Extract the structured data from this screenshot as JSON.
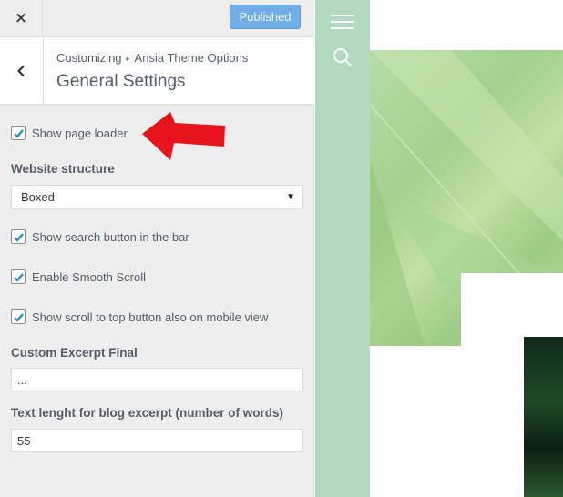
{
  "topbar": {
    "close_label": "×",
    "publish_label": "Published"
  },
  "section": {
    "breadcrumb_root": "Customizing",
    "breadcrumb_separator": "▸",
    "breadcrumb_parent": "Ansia Theme Options",
    "title": "General Settings"
  },
  "controls": {
    "show_page_loader": {
      "label": "Show page loader",
      "checked": true
    },
    "website_structure": {
      "title": "Website structure",
      "value": "Boxed"
    },
    "show_search_button": {
      "label": "Show search button in the bar",
      "checked": true
    },
    "smooth_scroll": {
      "label": "Enable Smooth Scroll",
      "checked": true
    },
    "scroll_top_mobile": {
      "label": "Show scroll to top button also on mobile view",
      "checked": true
    },
    "custom_excerpt_final": {
      "title": "Custom Excerpt Final",
      "value": "..."
    },
    "excerpt_length": {
      "title": "Text lenght for blog excerpt (number of words)",
      "value": "55"
    }
  },
  "colors": {
    "accent": "#1e8cbe",
    "publish_button": "#72aee6",
    "preview_nav": "#b3dac0",
    "annotation_arrow": "#e8141c"
  },
  "icons": {
    "close": "close-icon",
    "back": "chevron-left-icon",
    "checkbox": "checkmark-icon",
    "select": "caret-down-icon",
    "menu": "hamburger-menu-icon",
    "search": "search-icon",
    "annotation": "red-arrow-icon"
  }
}
